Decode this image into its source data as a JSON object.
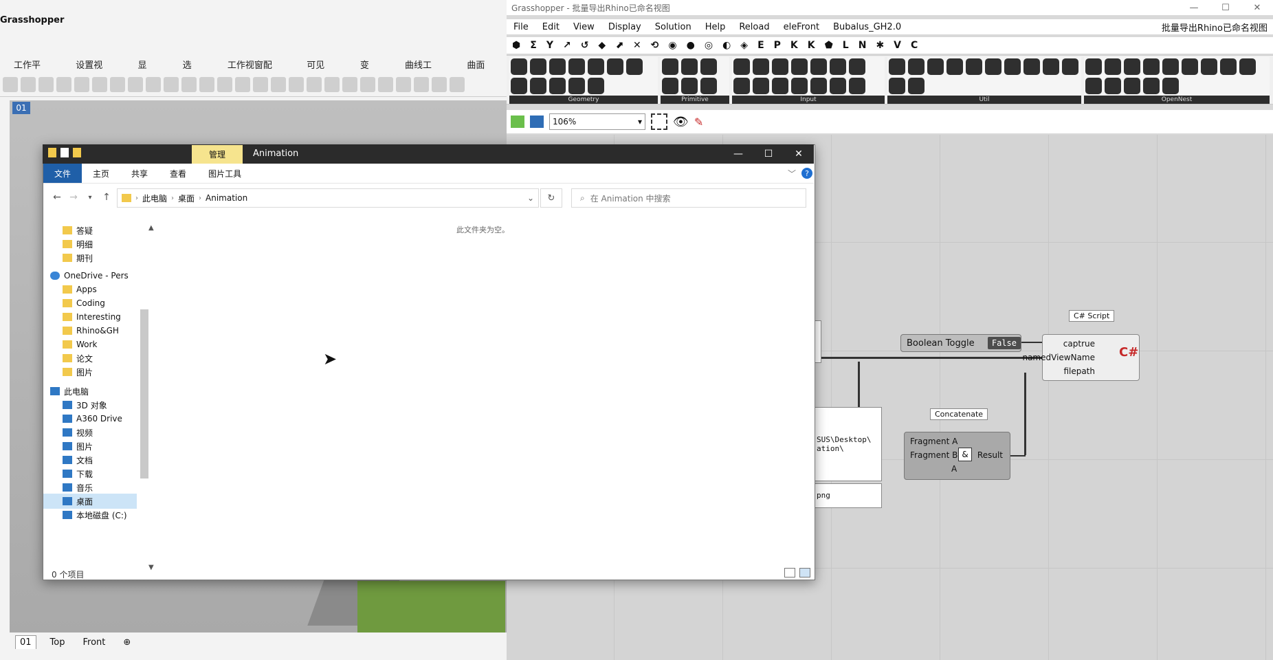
{
  "rhino": {
    "title": "Grasshopper",
    "tabs": [
      "工作平面",
      "设置视图",
      "显示",
      "选取",
      "工作视窗配置",
      "可见性",
      "变动",
      "曲线工具",
      "曲面工"
    ],
    "viewport_label": "01",
    "view_tabs": [
      "01",
      "Top",
      "Front"
    ],
    "view_add": "⊕"
  },
  "grasshopper": {
    "window_title": "Grasshopper - 批量导出Rhino已命名视图",
    "win_buttons": [
      "—",
      "☐",
      "✕"
    ],
    "menu": [
      "File",
      "Edit",
      "View",
      "Display",
      "Solution",
      "Help",
      "Reload",
      "eleFront",
      "Bubalus_GH2.0"
    ],
    "document_name": "批量导出Rhino已命名视图",
    "category_tabs": [
      "⬢",
      "Σ",
      "Y",
      "↗",
      "↺",
      "◆",
      "⬈",
      "✕",
      "⟲",
      "◉",
      "●",
      "◎",
      "◐",
      "◈",
      "E",
      "P",
      "K",
      "K",
      "⬟",
      "L",
      "N",
      "✱",
      "V",
      "C"
    ],
    "ribbon_groups": [
      {
        "label": "Geometry",
        "icons": 12
      },
      {
        "label": "Primitive",
        "icons": 6
      },
      {
        "label": "Input",
        "icons": 14
      },
      {
        "label": "Util",
        "icons": 12
      },
      {
        "label": "OpenNest",
        "icons": 14
      }
    ],
    "zoom_value": "106%",
    "components": {
      "cs_label": "C# Script",
      "cs_inputs": [
        "captrue",
        "namedViewName",
        "filepath"
      ],
      "cs_icon": "C#",
      "toggle_label": "Boolean Toggle",
      "toggle_value": "False",
      "concat_label": "Concatenate",
      "concat_inputs": [
        "Fragment A",
        "Fragment B",
        "A"
      ],
      "concat_output": "Result",
      "concat_icon": "&",
      "panel_path_text": "SUS\\Desktop\\\nation\\",
      "panel_png_text": "png"
    }
  },
  "explorer": {
    "title": "Animation",
    "manage_tab": "管理",
    "win_buttons": [
      "—",
      "☐",
      "✕"
    ],
    "ribbon_tabs": [
      "文件",
      "主页",
      "共享",
      "查看",
      "图片工具"
    ],
    "help_icon": "?",
    "address": [
      "此电脑",
      "桌面",
      "Animation"
    ],
    "search_placeholder": "在 Animation 中搜索",
    "empty_message": "此文件夹为空。",
    "status": "0 个项目",
    "nav_items": [
      {
        "label": "答疑",
        "icon": "folder-icon",
        "indent": 1
      },
      {
        "label": "明细",
        "icon": "folder-icon",
        "indent": 1
      },
      {
        "label": "期刊",
        "icon": "folder-icon",
        "indent": 1
      },
      {
        "label": "OneDrive - Pers",
        "icon": "cloud-icon",
        "indent": 0
      },
      {
        "label": "Apps",
        "icon": "folder-icon",
        "indent": 1
      },
      {
        "label": "Coding",
        "icon": "folder-icon",
        "indent": 1
      },
      {
        "label": "Interesting",
        "icon": "folder-icon",
        "indent": 1
      },
      {
        "label": "Rhino&GH",
        "icon": "folder-icon",
        "indent": 1
      },
      {
        "label": "Work",
        "icon": "folder-icon",
        "indent": 1
      },
      {
        "label": "论文",
        "icon": "folder-icon",
        "indent": 1
      },
      {
        "label": "图片",
        "icon": "folder-icon",
        "indent": 1
      },
      {
        "label": "此电脑",
        "icon": "pc-icon",
        "indent": 0
      },
      {
        "label": "3D 对象",
        "icon": "3d-icon",
        "indent": 1
      },
      {
        "label": "A360 Drive",
        "icon": "drive-icon",
        "indent": 1
      },
      {
        "label": "视频",
        "icon": "video-icon",
        "indent": 1
      },
      {
        "label": "图片",
        "icon": "pictures-icon",
        "indent": 1
      },
      {
        "label": "文档",
        "icon": "docs-icon",
        "indent": 1
      },
      {
        "label": "下载",
        "icon": "download-icon",
        "indent": 1
      },
      {
        "label": "音乐",
        "icon": "music-icon",
        "indent": 1
      },
      {
        "label": "桌面",
        "icon": "desktop-icon",
        "indent": 1,
        "selected": true
      },
      {
        "label": "本地磁盘 (C:)",
        "icon": "disk-icon",
        "indent": 1
      }
    ]
  },
  "colors": {
    "explorer_titlebar": "#2b2b2b",
    "manage_tab": "#f6e48e",
    "rhino_viewport_label": "#3b6fb4",
    "cs_icon": "#c62828"
  }
}
